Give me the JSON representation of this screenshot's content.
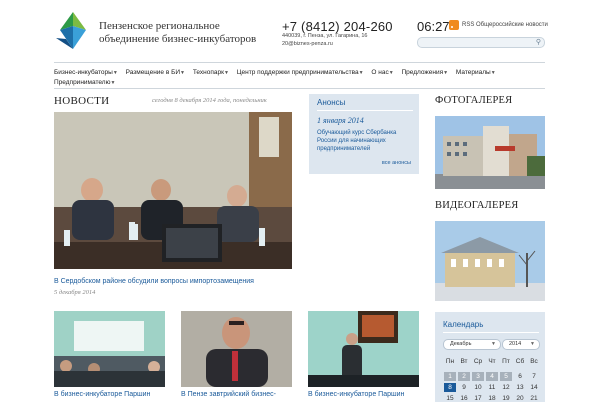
{
  "header": {
    "org_name": "Пензенское региональное объединение бизнес-инкубаторов",
    "phone": "+7 (8412) 204-260",
    "address_line1": "440039, г. Пенза, ул. Гагарина, 16",
    "address_line2": "20@biznes-penza.ru",
    "time": "06:27",
    "rss_label": "RSS Общероссийские новости",
    "search_placeholder": ""
  },
  "nav": {
    "items": [
      {
        "label": "Бизнес-инкубаторы",
        "has_dropdown": true
      },
      {
        "label": "Размещение в БИ",
        "has_dropdown": true
      },
      {
        "label": "Технопарк",
        "has_dropdown": true
      },
      {
        "label": "Центр поддержки предпринимательства",
        "has_dropdown": true
      },
      {
        "label": "О нас",
        "has_dropdown": true
      },
      {
        "label": "Предложения",
        "has_dropdown": true
      },
      {
        "label": "Материалы",
        "has_dropdown": true
      },
      {
        "label": "Предпринимателю",
        "has_dropdown": true
      }
    ]
  },
  "news": {
    "title": "НОВОСТИ",
    "today": "сегодня 8 декабря 2014 года, понедельник",
    "main": {
      "caption": "В Сердобском районе обсудили вопросы импортозамещения",
      "date": "5 декабря 2014"
    },
    "thumbs": [
      {
        "caption": "В бизнес-инкубаторе Паршин"
      },
      {
        "caption": "В Пензе завтрийский бизнес-"
      },
      {
        "caption": "В бизнес-инкубаторе Паршин"
      }
    ]
  },
  "announcements": {
    "title": "Анонсы",
    "date": "1 января 2014",
    "text": "Обучающий курс Сбербанка России для начинающих предпринимателей",
    "all_link": "все анонсы"
  },
  "photo_gallery": {
    "title": "ФОТОГАЛЕРЕЯ"
  },
  "video_gallery": {
    "title": "ВИДЕОГАЛЕРЕЯ"
  },
  "calendar": {
    "title": "Календарь",
    "month": "Декабрь",
    "year": "2014",
    "weekdays": [
      "Пн",
      "Вт",
      "Ср",
      "Чт",
      "Пт",
      "Сб",
      "Вс"
    ],
    "rows": [
      [
        {
          "d": "1",
          "s": "gray"
        },
        {
          "d": "2",
          "s": "gray"
        },
        {
          "d": "3",
          "s": "gray"
        },
        {
          "d": "4",
          "s": "gray"
        },
        {
          "d": "5",
          "s": "gray"
        },
        {
          "d": "6",
          "s": "norm"
        },
        {
          "d": "7",
          "s": "norm"
        }
      ],
      [
        {
          "d": "8",
          "s": "today"
        },
        {
          "d": "9",
          "s": "norm"
        },
        {
          "d": "10",
          "s": "norm"
        },
        {
          "d": "11",
          "s": "norm"
        },
        {
          "d": "12",
          "s": "norm"
        },
        {
          "d": "13",
          "s": "norm"
        },
        {
          "d": "14",
          "s": "norm"
        }
      ],
      [
        {
          "d": "15",
          "s": "norm"
        },
        {
          "d": "16",
          "s": "norm"
        },
        {
          "d": "17",
          "s": "norm"
        },
        {
          "d": "18",
          "s": "norm"
        },
        {
          "d": "19",
          "s": "norm"
        },
        {
          "d": "20",
          "s": "norm"
        },
        {
          "d": "21",
          "s": "norm"
        }
      ]
    ]
  },
  "colors": {
    "accent": "#1a5a9a",
    "panel": "#dde6ef",
    "rss": "#f08a1c"
  }
}
